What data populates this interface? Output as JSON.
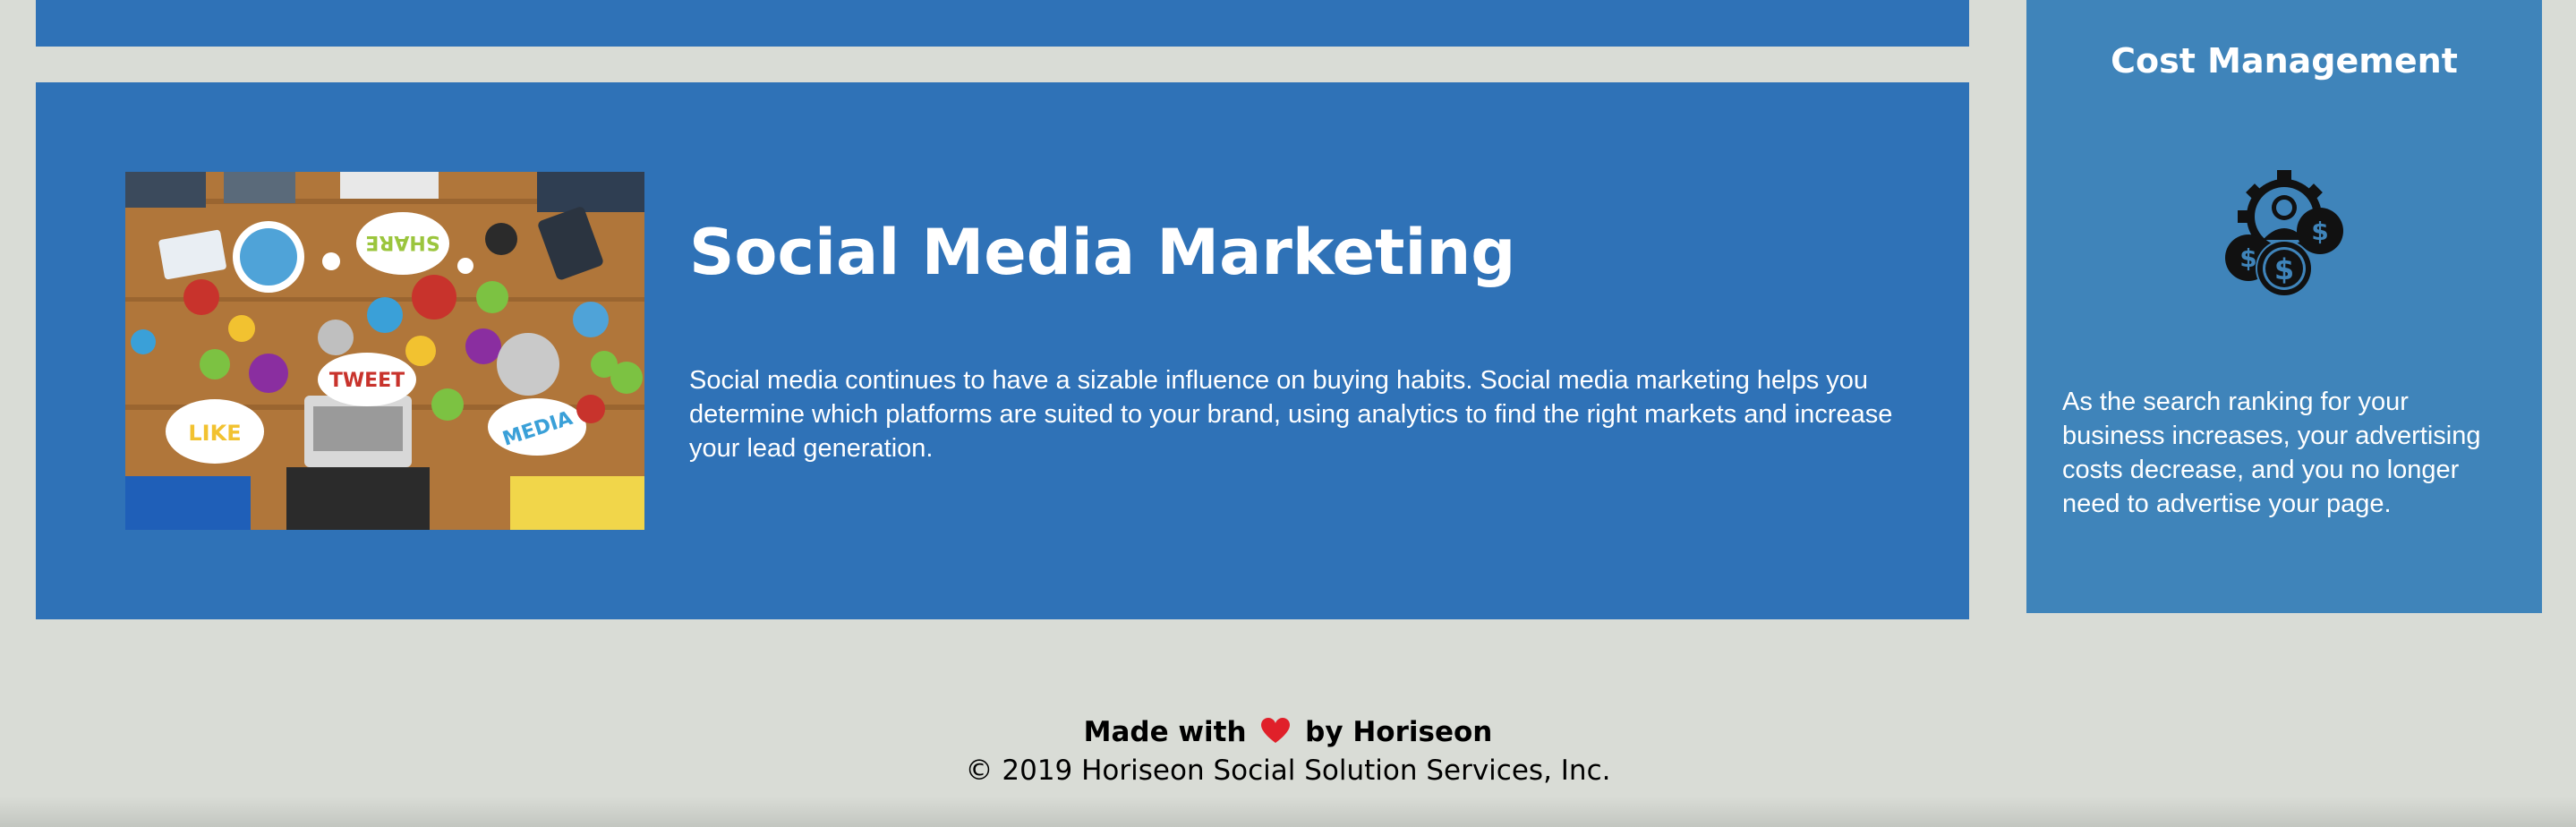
{
  "main": {
    "article": {
      "title": "Social Media Marketing",
      "text": "Social media continues to have a sizable influence on buying habits. Social media marketing helps you determine which platforms are suited to your brand, using analytics to find the right markets and increase your lead generation.",
      "image_words": [
        "SHARE",
        "TWEET",
        "LIKE",
        "MEDIA"
      ]
    }
  },
  "sidebar": {
    "title": "Cost Management",
    "text": "As the search ranking for your business increases, your advertising costs decrease, and you no longer need to advertise your page.",
    "icon": "cost-management-icon"
  },
  "footer": {
    "made_with": "Made with",
    "by": "by Horiseon",
    "copyright": "© 2019 Horiseon Social Solution Services, Inc."
  },
  "colors": {
    "background": "#d9dcd6",
    "article_bg": "#2f72b7",
    "aside_bg": "#3f84ba",
    "heart": "#e0202a"
  }
}
